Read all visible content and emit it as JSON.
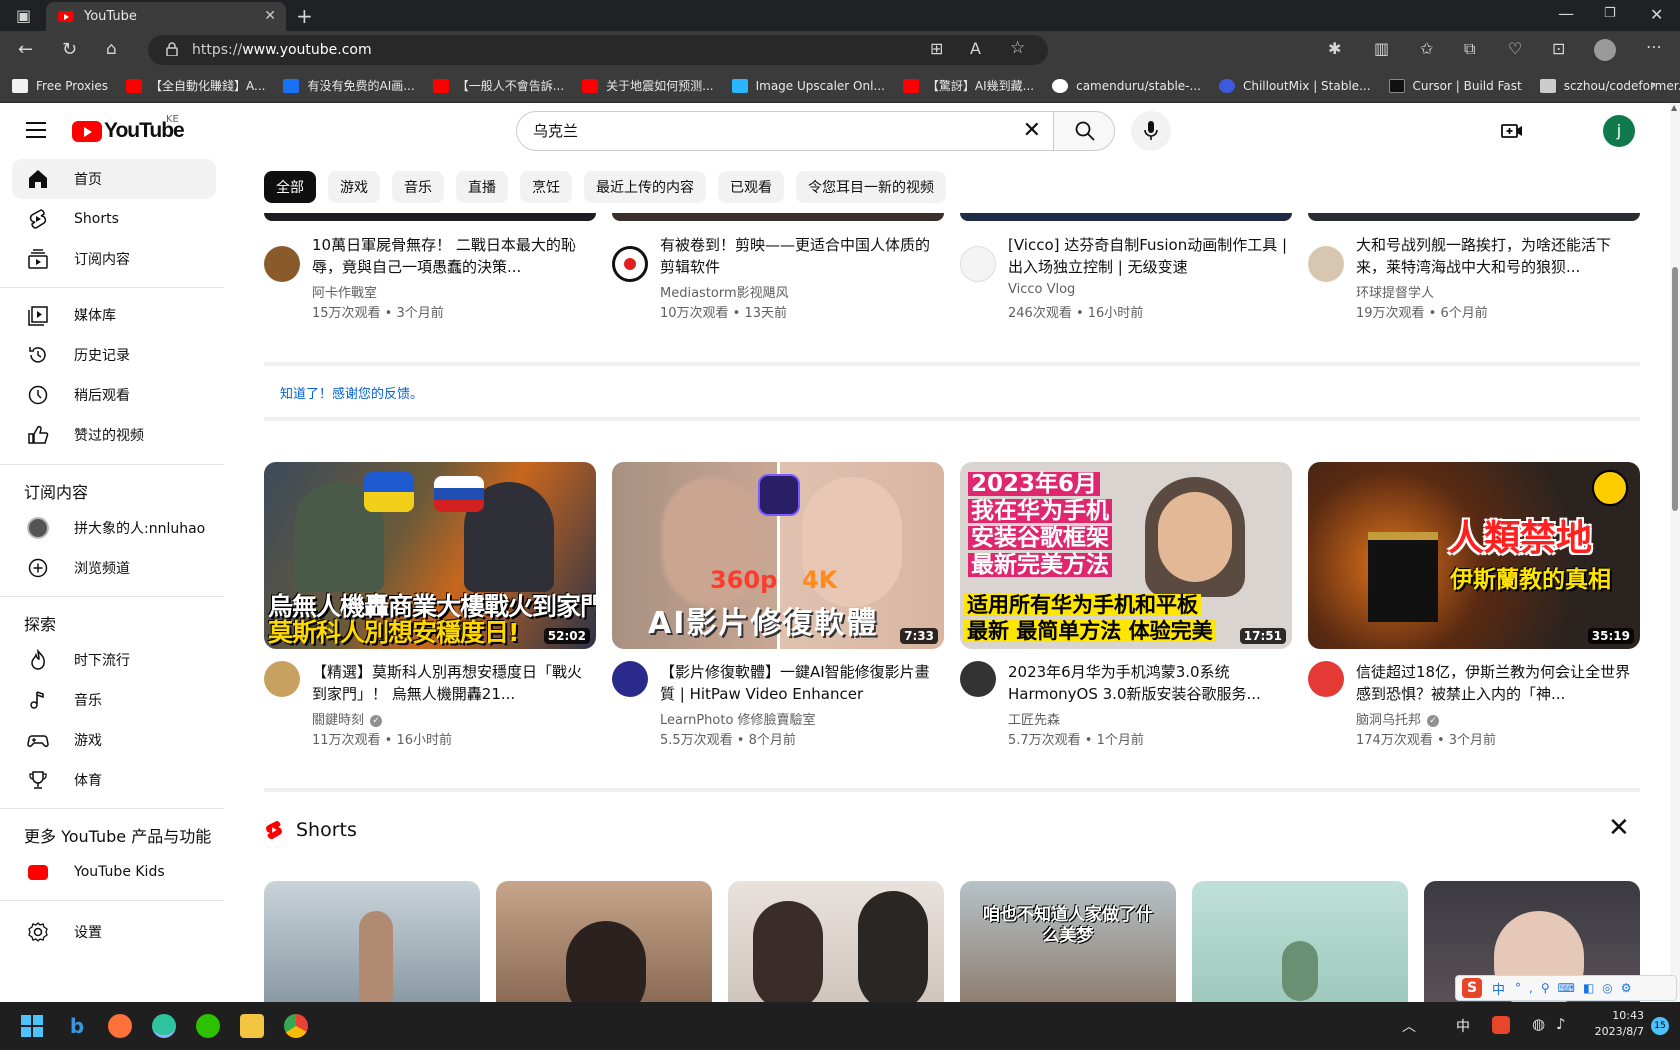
{
  "browser": {
    "tab_title": "YouTube",
    "url_scheme": "https://",
    "url_host": "www.youtube.com",
    "bookmarks": [
      {
        "label": "Free Proxies",
        "color": "#f2f2f2"
      },
      {
        "label": "【全自動化賺錢】A...",
        "color": "#ff0000"
      },
      {
        "label": "有没有免费的AI画...",
        "color": "#1772f6"
      },
      {
        "label": "【一般人不會告訴...",
        "color": "#ff0000"
      },
      {
        "label": "关于地震如何预测...",
        "color": "#ff0000"
      },
      {
        "label": "Image Upscaler Onl...",
        "color": "#2bb5ff"
      },
      {
        "label": "【驚訝】AI幾到藏...",
        "color": "#ff0000"
      },
      {
        "label": "camenduru/stable-...",
        "color": "#ffffff"
      },
      {
        "label": "ChilloutMix | Stable...",
        "color": "#3b5bdb"
      },
      {
        "label": "Cursor | Build Fast",
        "color": "#111111"
      },
      {
        "label": "sczhou/codeformer...",
        "color": "#cccccc"
      }
    ]
  },
  "masthead": {
    "logo_text": "YouTube",
    "country_code": "KE",
    "search_value": "乌克兰",
    "avatar_letter": "j"
  },
  "sidebar": {
    "main": [
      "首页",
      "Shorts",
      "订阅内容"
    ],
    "library": [
      "媒体库",
      "历史记录",
      "稍后观看",
      "赞过的视频"
    ],
    "subs_heading": "订阅内容",
    "subs": [
      "拼大象的人:nnluhao",
      "浏览频道"
    ],
    "explore_heading": "探索",
    "explore": [
      "时下流行",
      "音乐",
      "游戏",
      "体育"
    ],
    "more_heading": "更多 YouTube 产品与功能",
    "more": [
      "YouTube Kids"
    ],
    "settings": "设置"
  },
  "chips": [
    "全部",
    "游戏",
    "音乐",
    "直播",
    "烹饪",
    "最近上传的内容",
    "已观看",
    "令您耳目一新的视频"
  ],
  "row_top": [
    {
      "title": "10萬日軍屍骨無存！ 二戰日本最大的恥辱，竟與自己一項愚蠢的決策...",
      "channel": "阿卡作戰室",
      "stats": "15万次观看 • 3个月前",
      "avatar_color": "#8a5a2b"
    },
    {
      "title": "有被卷到！剪映——更适合中国人体质的剪辑软件",
      "channel": "Mediastorm影视飓风",
      "stats": "10万次观看 • 13天前",
      "avatar_color": "#ffffff"
    },
    {
      "title": "[Vicco] 达芬奇自制Fusion动画制作工具 | 出入场独立控制 | 无级变速",
      "channel": "Vicco Vlog",
      "stats": "246次观看 • 16小时前",
      "avatar_color": "#f4f4f4"
    },
    {
      "title": "大和号战列舰一路挨打，为啥还能活下来，莱特湾海战中大和号的狼狈...",
      "channel": "环球提督学人",
      "stats": "19万次观看 • 6个月前",
      "avatar_color": "#d8c7b0"
    }
  ],
  "feedback_text": "知道了！感谢您的反馈。",
  "row_main": [
    {
      "title": "【精選】莫斯科人別再想安穩度日「戰火到家門」！ 烏無人機開轟21...",
      "channel": "關鍵時刻",
      "verified": true,
      "stats": "11万次观看 • 16小时前",
      "duration": "52:02",
      "overlay_line1": "烏無人機轟商業大樓戰火到家門",
      "overlay_line2": "莫斯科人別想安穩度日!",
      "avatar_color": "#c8a060"
    },
    {
      "title": "【影片修復軟體】一鍵AI智能修復影片畫質 | HitPaw Video Enhancer",
      "channel": "LearnPhoto 修修臉賣驗室",
      "verified": false,
      "stats": "5.5万次观看 • 8个月前",
      "duration": "7:33",
      "overlay_line1": "AI影片修復軟體",
      "overlay_tag1": "360p",
      "overlay_tag2": "4K",
      "avatar_color": "#2a2a8a"
    },
    {
      "title": "2023年6月华为手机鸿蒙3.0系统HarmonyOS 3.0新版安装谷歌服务...",
      "channel": "工匠先森",
      "verified": false,
      "stats": "5.7万次观看 • 1个月前",
      "duration": "17:51",
      "overlay_line1": "2023年6月",
      "overlay_line2": "我在华为手机",
      "overlay_line3": "安装谷歌框架",
      "overlay_line4": "最新完美方法",
      "overlay_line5": "适用所有华为手机和平板",
      "overlay_line6": "最新 最简单方法 体验完美",
      "avatar_color": "#333333"
    },
    {
      "title": "信徒超过18亿，伊斯兰教为何会让全世界感到恐惧？被禁止入内的「神...",
      "channel": "脑洞乌托邦",
      "verified": true,
      "stats": "174万次观看 • 3个月前",
      "duration": "35:19",
      "overlay_line1": "人類禁地",
      "overlay_line2": "伊斯蘭教的真相",
      "avatar_color": "#e53935"
    }
  ],
  "shorts": {
    "heading": "Shorts",
    "captions": [
      "",
      "",
      "",
      "咱也不知道人家做了什么美梦",
      "",
      ""
    ]
  },
  "taskbar": {
    "time": "10:43",
    "date": "2023/8/7",
    "ime": "中",
    "notif_count": "15"
  },
  "colors": {
    "yt_red": "#ff0000",
    "chip_active": "#0f0f0f",
    "feedback_link": "#065fd4"
  }
}
